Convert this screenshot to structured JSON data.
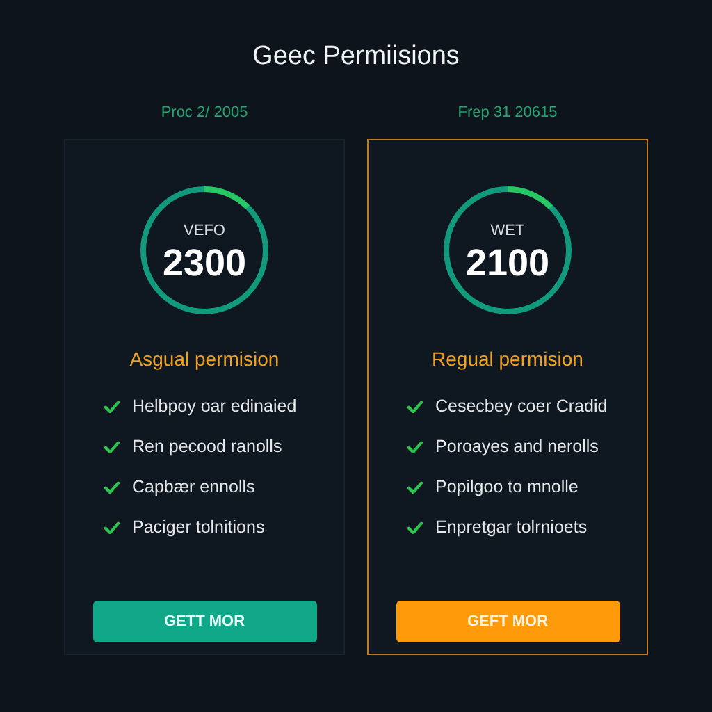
{
  "title": "Geec Permiisions",
  "plans": [
    {
      "label": "Proc 2/ 2005",
      "selected": false,
      "ring_label": "VEFO",
      "value": "2300",
      "heading": "Asgual permision",
      "features": [
        "Helbpoy oar edinaied",
        "Ren pecood ranolls",
        "Capbær ennolls",
        "Paciger tolnitions"
      ],
      "button": "GETT MOR"
    },
    {
      "label": "Frep 31 20615",
      "selected": true,
      "ring_label": "WET",
      "value": "2100",
      "heading": "Regual permision",
      "features": [
        "Cesecbey coer Cradid",
        "Poroayes and nerolls",
        "Popilgoo to mnolle",
        "Enpretgar tolrnioets"
      ],
      "button": "GEFT MOR"
    }
  ]
}
